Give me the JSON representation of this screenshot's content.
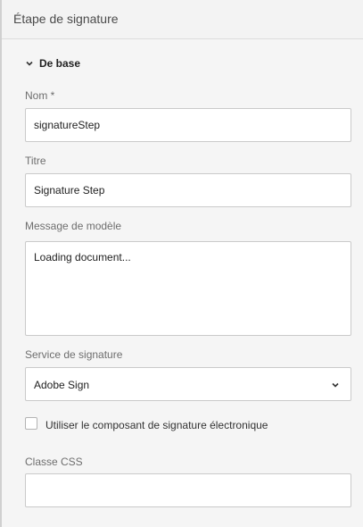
{
  "header": {
    "title": "Étape de signature"
  },
  "section": {
    "label": "De base",
    "expanded": true
  },
  "fields": {
    "name": {
      "label": "Nom *",
      "value": "signatureStep"
    },
    "title": {
      "label": "Titre",
      "value": "Signature Step"
    },
    "template_message": {
      "label": "Message de modèle",
      "value": "Loading document..."
    },
    "signing_service": {
      "label": "Service de signature",
      "selected": "Adobe Sign"
    },
    "use_esign_component": {
      "label": "Utiliser le composant de signature électronique",
      "checked": false
    },
    "css_class": {
      "label": "Classe CSS",
      "value": ""
    }
  },
  "icons": {
    "section_chevron": "chevron-down-icon",
    "select_chevron": "chevron-down-icon"
  },
  "colors": {
    "background": "#f5f5f5",
    "field_border": "#cacaca",
    "label": "#6e6e6e"
  }
}
